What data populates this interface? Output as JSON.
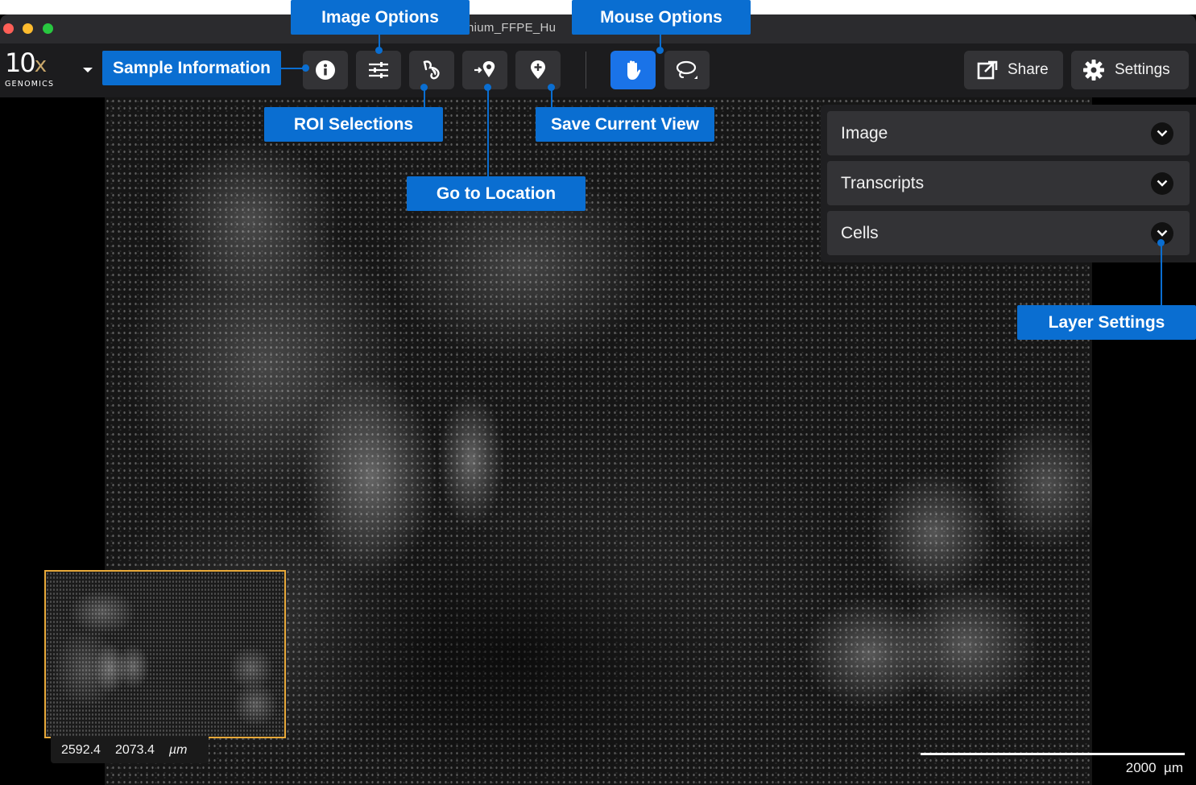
{
  "window": {
    "title": "nium_FFPE_Hu"
  },
  "toolbar": {
    "logo_main": "10",
    "logo_x": "x",
    "logo_sub": "GENOMICS",
    "share_label": "Share",
    "settings_label": "Settings"
  },
  "layers": [
    {
      "label": "Image"
    },
    {
      "label": "Transcripts"
    },
    {
      "label": "Cells"
    }
  ],
  "minimap": {
    "x": "2592.4",
    "y": "2073.4",
    "unit": "µm"
  },
  "scale_bar": {
    "label": "2000  µm"
  },
  "callouts": {
    "sample_information": "Sample Information",
    "image_options": "Image Options",
    "mouse_options": "Mouse Options",
    "roi_selections": "ROI Selections",
    "save_current_view": "Save Current View",
    "go_to_location": "Go to Location",
    "layer_settings": "Layer Settings"
  },
  "colors": {
    "accent": "#1a73e8",
    "callout": "#0a6ed1",
    "minimap_border": "#e8a93a"
  }
}
